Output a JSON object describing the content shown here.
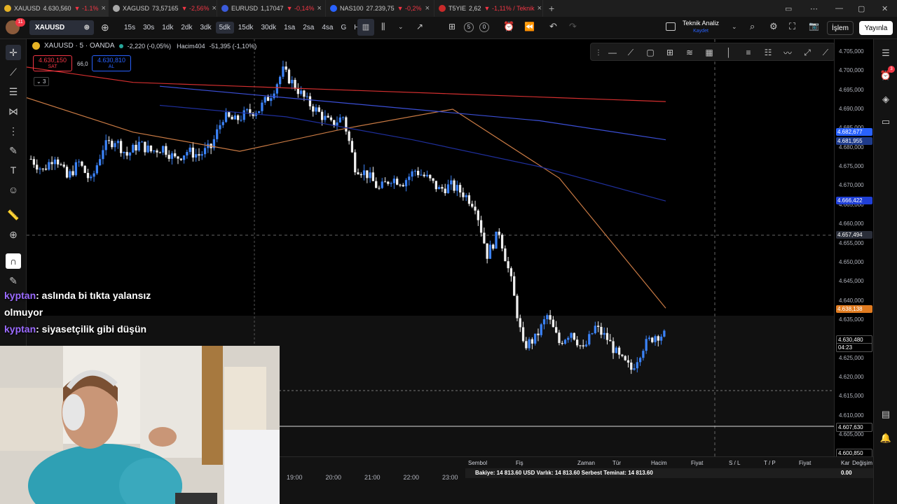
{
  "tabs": [
    {
      "symbol": "XAUUSD",
      "price": "4.630,560",
      "change": "▼ -1.1%",
      "active": true,
      "icon_color": "#e6b325"
    },
    {
      "symbol": "XAGUSD",
      "price": "73,57165",
      "change": "▼ -2,56%",
      "active": false,
      "icon_color": "#aaaaaa"
    },
    {
      "symbol": "EURUSD",
      "price": "1,17047",
      "change": "▼ -0,14%",
      "active": false,
      "icon_color": "#3b5bdb"
    },
    {
      "symbol": "NAS100",
      "price": "27.239,75",
      "change": "▼ -0,2%",
      "active": false,
      "icon_color": "#2962ff"
    },
    {
      "symbol": "T5YIE",
      "price": "2,62",
      "change": "▼ -1,11% / Teknik",
      "active": false,
      "icon_color": "#c92a2a"
    }
  ],
  "toolbar": {
    "symbol": "XAUUSD",
    "notif_count": "11",
    "intervals": [
      "15s",
      "30s",
      "1dk",
      "2dk",
      "3dk",
      "5dk",
      "15dk",
      "30dk",
      "1sa",
      "2sa",
      "4sa",
      "G",
      "H"
    ],
    "selected_interval": "5dk",
    "counter_a": "5",
    "counter_b": "0",
    "analysis_title": "Teknik Analiz",
    "analysis_sub": "Kaydet",
    "islem_label": "İşlem",
    "yayinla_label": "Yayınla"
  },
  "legend": {
    "title": "XAUUSD · 5 · OANDA",
    "change": "-2,220 (-0,05%)",
    "volume_label": "Hacim",
    "volume_value": "404",
    "volume_change": "-51,395 (-1,10%)",
    "sell_price": "4.630,150",
    "sell_label": "SAT",
    "spread": "66,0",
    "buy_price": "4.630,810",
    "buy_label": "AL",
    "collapse_count": "3"
  },
  "price_axis": {
    "ticks": [
      "4.705,000",
      "4.700,000",
      "4.695,000",
      "4.690,000",
      "4.685,000",
      "4.680,000",
      "4.675,000",
      "4.670,000",
      "4.665,000",
      "4.660,000",
      "4.655,000",
      "4.650,000",
      "4.645,000",
      "4.640,000",
      "4.635,000",
      "4.630,000",
      "4.625,000",
      "4.620,000",
      "4.615,000",
      "4.610,000",
      "4.605,000",
      "4.600,000"
    ],
    "badges": [
      {
        "label": "4.682,677",
        "color": "#2962ff"
      },
      {
        "label": "4.681,955",
        "color": "#1e3a8a"
      },
      {
        "label": "4.666,422",
        "color": "#1f3fd6"
      },
      {
        "label": "4.657,494",
        "color": "#2a2e39"
      },
      {
        "label": "4.638,138",
        "color": "#e07b20"
      },
      {
        "label": "4.630,480",
        "color": "#000000"
      },
      {
        "label": "04:23",
        "color": "#000000"
      },
      {
        "label": "4.607,630",
        "color": "#000000"
      },
      {
        "label": "4.600,850",
        "color": "#000000"
      }
    ]
  },
  "time_axis": {
    "labels": [
      "19:00",
      "20:00",
      "21:00",
      "22:00",
      "23:00"
    ]
  },
  "chat": [
    {
      "user": "kyptan",
      "text": ": aslında bi tıkta yalansız olmuyor"
    },
    {
      "user": "kyptan",
      "text": ": siyasetçilik gibi düşün"
    }
  ],
  "orders": {
    "headers": [
      "Sembol",
      "Fiş",
      "Zaman",
      "Tür",
      "Hacim",
      "Fiyat",
      "S / L",
      "T / P",
      "Fiyat",
      "Kar",
      "Değişim"
    ],
    "balance_text": "Bakiye: 14 813.60 USD  Varlık: 14 813.60  Serbest Teminat: 14 813.60",
    "profit": "0.00"
  },
  "chart_data": {
    "type": "candlestick",
    "symbol": "XAUUSD",
    "interval": "5",
    "ylim": [
      4600,
      4705
    ],
    "x_labels": [
      "19:00",
      "20:00",
      "21:00",
      "22:00",
      "23:00"
    ],
    "close_path": [
      4677,
      4674,
      4678,
      4672,
      4676,
      4671,
      4680,
      4682,
      4678,
      4681,
      4679,
      4680,
      4677,
      4679,
      4678,
      4680,
      4688,
      4687,
      4689,
      4690,
      4694,
      4700,
      4696,
      4692,
      4689,
      4686,
      4688,
      4675,
      4673,
      4669,
      4672,
      4671,
      4674,
      4672,
      4669,
      4670,
      4668,
      4665,
      4652,
      4658,
      4645,
      4628,
      4630,
      4636,
      4629,
      4632,
      4627,
      4633,
      4630,
      4625,
      4622,
      4628,
      4631
    ],
    "moving_averages": [
      {
        "name": "ma_red",
        "color": "#d32f2f",
        "values": [
          4701,
          4697,
          4696,
          4695,
          4694,
          4693,
          4692
        ]
      },
      {
        "name": "ma_orange",
        "color": "#c97a44",
        "values": [
          4693,
          4684,
          4679,
          4685,
          4690,
          4672,
          4638
        ]
      },
      {
        "name": "ma_blue",
        "color": "#3b4fd6",
        "values": [
          4696,
          4693,
          4690,
          4687,
          4682
        ]
      },
      {
        "name": "ma_navy",
        "color": "#1f2f9c",
        "values": [
          4691,
          4688,
          4682,
          4675,
          4666
        ]
      }
    ]
  }
}
